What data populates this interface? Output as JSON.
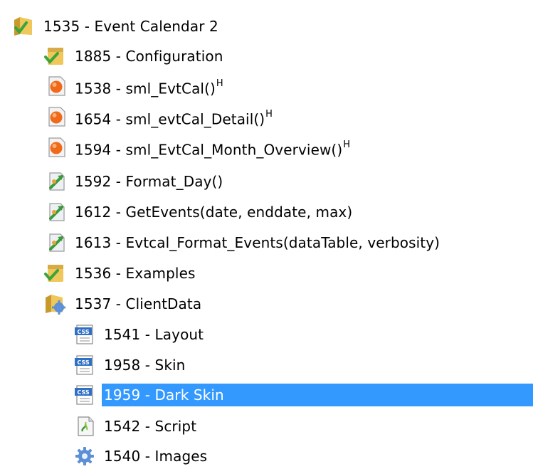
{
  "tree": {
    "root": {
      "label": "1535 - Event Calendar 2",
      "icon": "folder-check-icon"
    },
    "configuration": {
      "label": "1885 - Configuration",
      "icon": "folder-check-icon"
    },
    "sml_evtcal": {
      "label": "1538 - sml_EvtCal()",
      "badge": "H",
      "icon": "orange-dot-document-icon"
    },
    "sml_evtcal_detail": {
      "label": "1654 - sml_evtCal_Detail()",
      "badge": "H",
      "icon": "orange-dot-document-icon"
    },
    "sml_evtcal_month": {
      "label": "1594 - sml_EvtCal_Month_Overview()",
      "badge": "H",
      "icon": "orange-dot-document-icon"
    },
    "format_day": {
      "label": "1592 - Format_Day()",
      "icon": "script-function-icon"
    },
    "get_events": {
      "label": "1612 - GetEvents(date, enddate, max)",
      "icon": "script-function-icon"
    },
    "format_events": {
      "label": "1613 - Evtcal_Format_Events(dataTable, verbosity)",
      "icon": "script-function-icon"
    },
    "examples": {
      "label": "1536 - Examples",
      "icon": "folder-check-icon"
    },
    "clientdata": {
      "label": "1537 - ClientData",
      "icon": "folder-gear-icon"
    },
    "layout": {
      "label": "1541 - Layout",
      "icon": "css-file-icon"
    },
    "skin": {
      "label": "1958 - Skin",
      "icon": "css-file-icon"
    },
    "dark_skin": {
      "label": "1959 - Dark Skin",
      "icon": "css-file-icon",
      "selected": true
    },
    "script": {
      "label": "1542 - Script",
      "icon": "script-file-icon"
    },
    "images": {
      "label": "1540 - Images",
      "icon": "gear-icon"
    }
  },
  "colors": {
    "selection": "#3399ff",
    "folder": "#e8b94a",
    "check": "#3aa53a",
    "orange_dot": "#f06a1a"
  }
}
